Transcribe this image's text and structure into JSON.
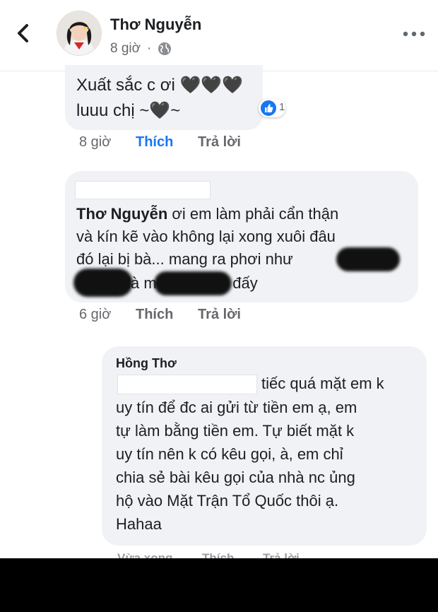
{
  "header": {
    "name": "Thơ Nguyễn",
    "time": "8 giờ",
    "dot": "·"
  },
  "comments": [
    {
      "lines": [
        "Xuất sắc c ơi 🖤🖤🖤",
        "luuu chị ~🖤~"
      ],
      "reaction_count": "1",
      "actions": {
        "time": "8 giờ",
        "like": "Thích",
        "reply": "Trả lời"
      },
      "like_active": true
    },
    {
      "mention": "Thơ Nguyễn",
      "lines": [
        " ơi em làm phải cẩn thận",
        "và kín kẽ vào không lại xong xuôi đâu",
        "đó lại bị bà... mang ra phơi như",
        "th        và                      n là mệt mỏi lắm đấy"
      ],
      "actions": {
        "time": "6 giờ",
        "like": "Thích",
        "reply": "Trả lời"
      }
    },
    {
      "author": "Hồng Thơ",
      "lines": [
        "tiếc quá mặt em k",
        "uy tín để đc ai gửi từ tiền em ạ, em",
        "tự làm bằng tiền em. Tự biết mặt k",
        "uy tín nên k có kêu gọi, à, em chỉ",
        "chia sẻ bài kêu gọi của nhà nc ủng",
        "hộ vào Mặt Trận Tổ Quốc thôi ạ.",
        "Hahaa"
      ],
      "actions": {
        "time": "Vừa xong",
        "like": "Thích",
        "reply": "Trả lời"
      }
    }
  ],
  "colors": {
    "bubble": "#f0f2f5",
    "accent": "#1877f2",
    "muted": "#65676b"
  },
  "icons": [
    "back-icon",
    "globe-icon",
    "more-icon",
    "like-icon"
  ]
}
